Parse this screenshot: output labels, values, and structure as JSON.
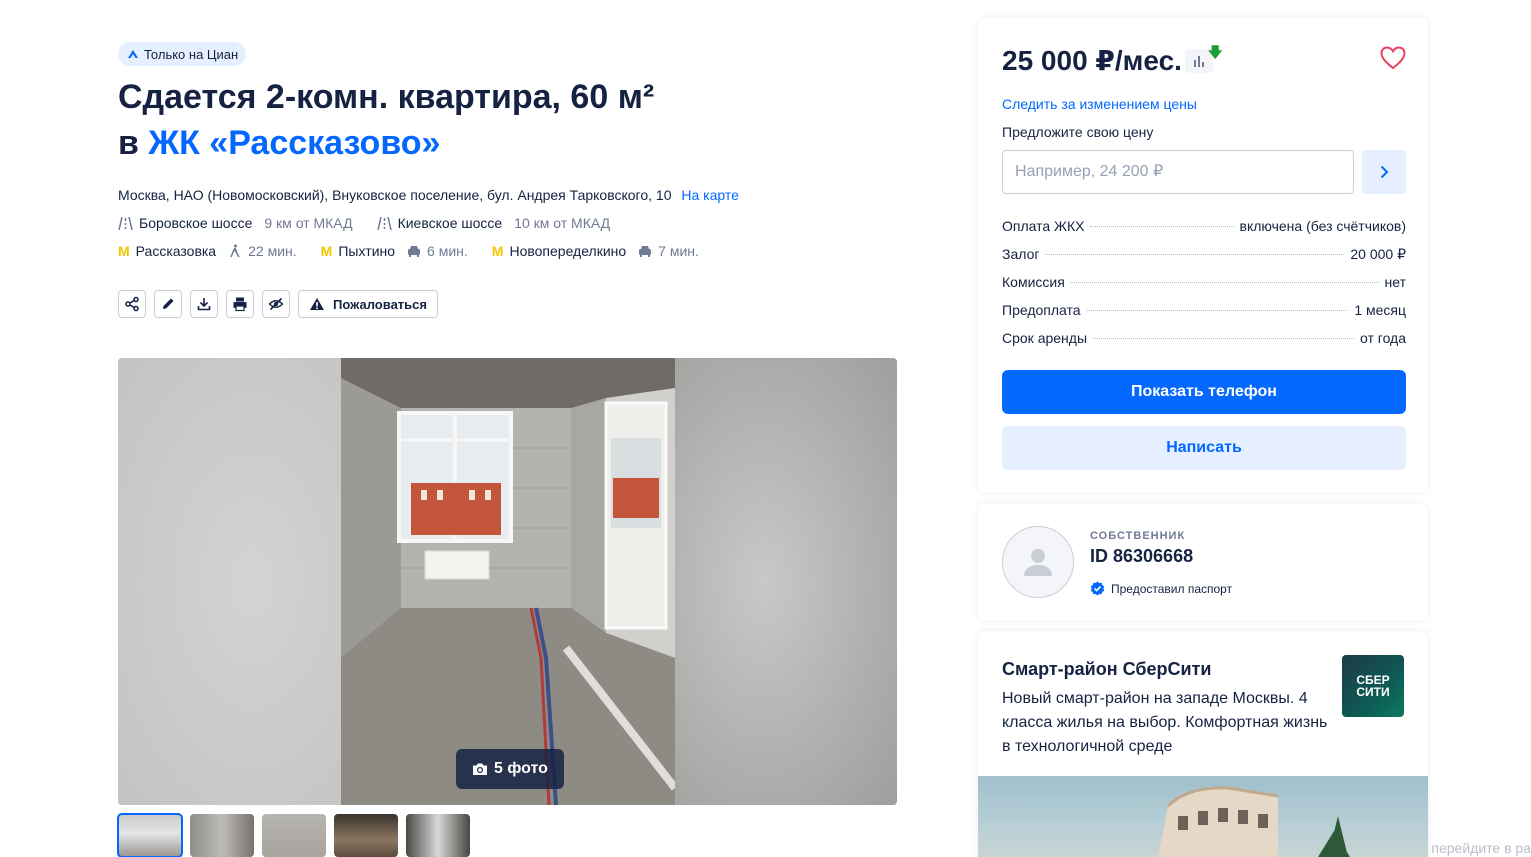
{
  "badge": {
    "label": "Только на Циан"
  },
  "title": {
    "line1": "Сдается 2-комн. квартира, 60 м²",
    "prefix": "в ",
    "complex": "ЖК «Рассказово»"
  },
  "address": {
    "text": "Москва, НАО (Новомосковский), Внуковское поселение, бул. Андрея Тарковского, 10",
    "map_link": "На карте"
  },
  "highways": [
    {
      "name": "Боровское шоссе",
      "distance": "9 км от МКАД"
    },
    {
      "name": "Киевское шоссе",
      "distance": "10 км от МКАД"
    }
  ],
  "metro": [
    {
      "name": "Рассказовка",
      "time": "22 мин.",
      "transport": "walk"
    },
    {
      "name": "Пыхтино",
      "time": "6 мин.",
      "transport": "car"
    },
    {
      "name": "Новопеределкино",
      "time": "7 мин.",
      "transport": "car"
    }
  ],
  "toolbar": {
    "complain": "Пожаловаться"
  },
  "gallery": {
    "photo_count": "5 фото"
  },
  "price": {
    "value": "25 000 ₽/мес.",
    "track_link": "Следить за изменением цены",
    "offer_label": "Предложите свою цену",
    "offer_placeholder": "Например, 24 200 ₽"
  },
  "terms": [
    {
      "label": "Оплата ЖКХ",
      "value": "включена (без счётчиков)"
    },
    {
      "label": "Залог",
      "value": "20 000 ₽"
    },
    {
      "label": "Комиссия",
      "value": "нет"
    },
    {
      "label": "Предоплата",
      "value": "1 месяц"
    },
    {
      "label": "Срок аренды",
      "value": "от года"
    }
  ],
  "actions": {
    "phone": "Показать телефон",
    "write": "Написать"
  },
  "owner": {
    "type": "СОБСТВЕННИК",
    "id": "ID 86306668",
    "verified": "Предоставил паспорт"
  },
  "ad": {
    "title": "Смарт-район СберСити",
    "text": "Новый смарт-район на западе Москвы. 4 класса жилья на выбор. Комфортная жизнь в технологичной среде",
    "logo_line1": "СБЕР",
    "logo_line2": "СИТИ"
  },
  "watermark": "перейдите в ра",
  "colors": {
    "accent": "#0468ff",
    "text": "#152242",
    "muted": "#707a95",
    "metro": "#f4c600",
    "light_blue": "#e6efff"
  }
}
